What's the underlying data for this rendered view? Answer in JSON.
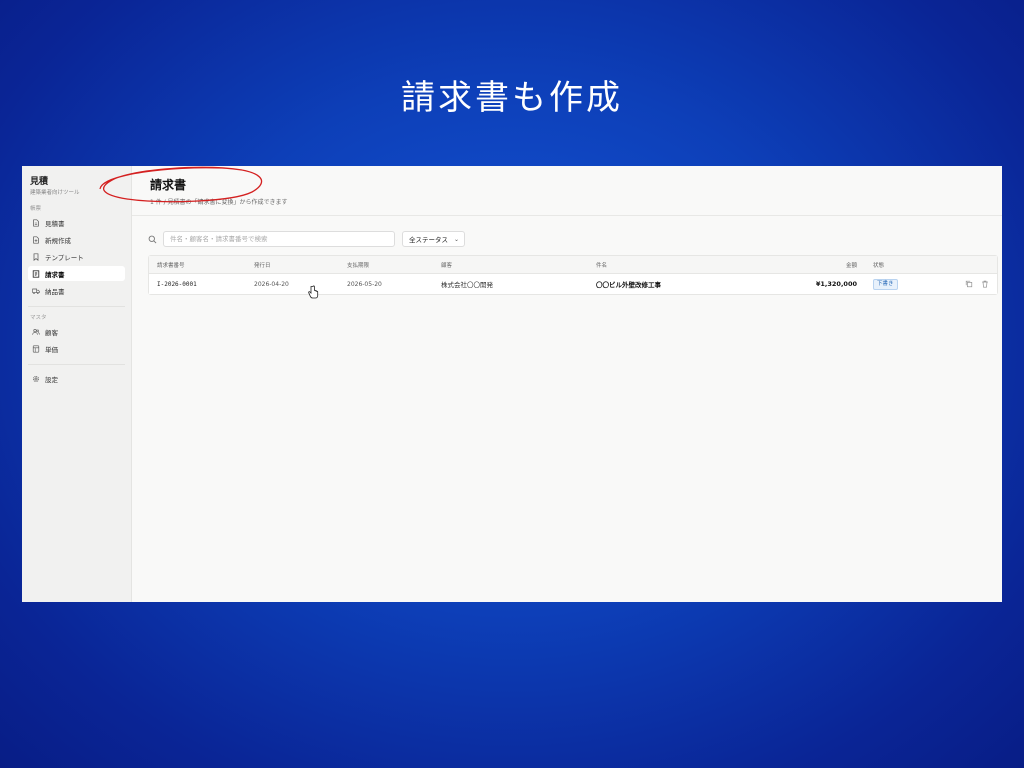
{
  "slide": {
    "title": "請求書も作成"
  },
  "sidebar": {
    "brand": {
      "name": "見積",
      "subtitle": "建築業者向けツール"
    },
    "sections": [
      {
        "label": "帳票",
        "items": [
          {
            "label": "見積書",
            "icon": "document-icon",
            "active": false
          },
          {
            "label": "新規作成",
            "icon": "document-plus-icon",
            "active": false
          },
          {
            "label": "テンプレート",
            "icon": "bookmark-icon",
            "active": false
          },
          {
            "label": "請求書",
            "icon": "invoice-icon",
            "active": true
          },
          {
            "label": "納品書",
            "icon": "truck-icon",
            "active": false
          }
        ]
      },
      {
        "label": "マスタ",
        "items": [
          {
            "label": "顧客",
            "icon": "users-icon",
            "active": false
          },
          {
            "label": "単価",
            "icon": "price-list-icon",
            "active": false
          }
        ]
      }
    ],
    "settings": {
      "label": "設定",
      "icon": "gear-icon"
    }
  },
  "page": {
    "title": "請求書",
    "subtitle": "1 件 / 見積書の「請求書に変換」から作成できます"
  },
  "toolbar": {
    "search_placeholder": "件名・顧客名・請求書番号で検索",
    "status_filter": "全ステータス"
  },
  "table": {
    "columns": {
      "number": "請求書番号",
      "issue_date": "発行日",
      "due_date": "支払期限",
      "customer": "顧客",
      "subject": "件名",
      "amount": "金額",
      "status": "状態"
    },
    "rows": [
      {
        "number": "I-2026-0001",
        "issue_date": "2026-04-20",
        "due_date": "2026-05-20",
        "customer": "株式会社〇〇開発",
        "subject": "〇〇ビル外壁改修工事",
        "amount": "¥1,320,000",
        "status": "下書き"
      }
    ]
  },
  "colors": {
    "background_center": "#1556d8",
    "background_edge": "#081d86",
    "annotation": "#d42020",
    "status_badge": "#2a6bb8"
  }
}
